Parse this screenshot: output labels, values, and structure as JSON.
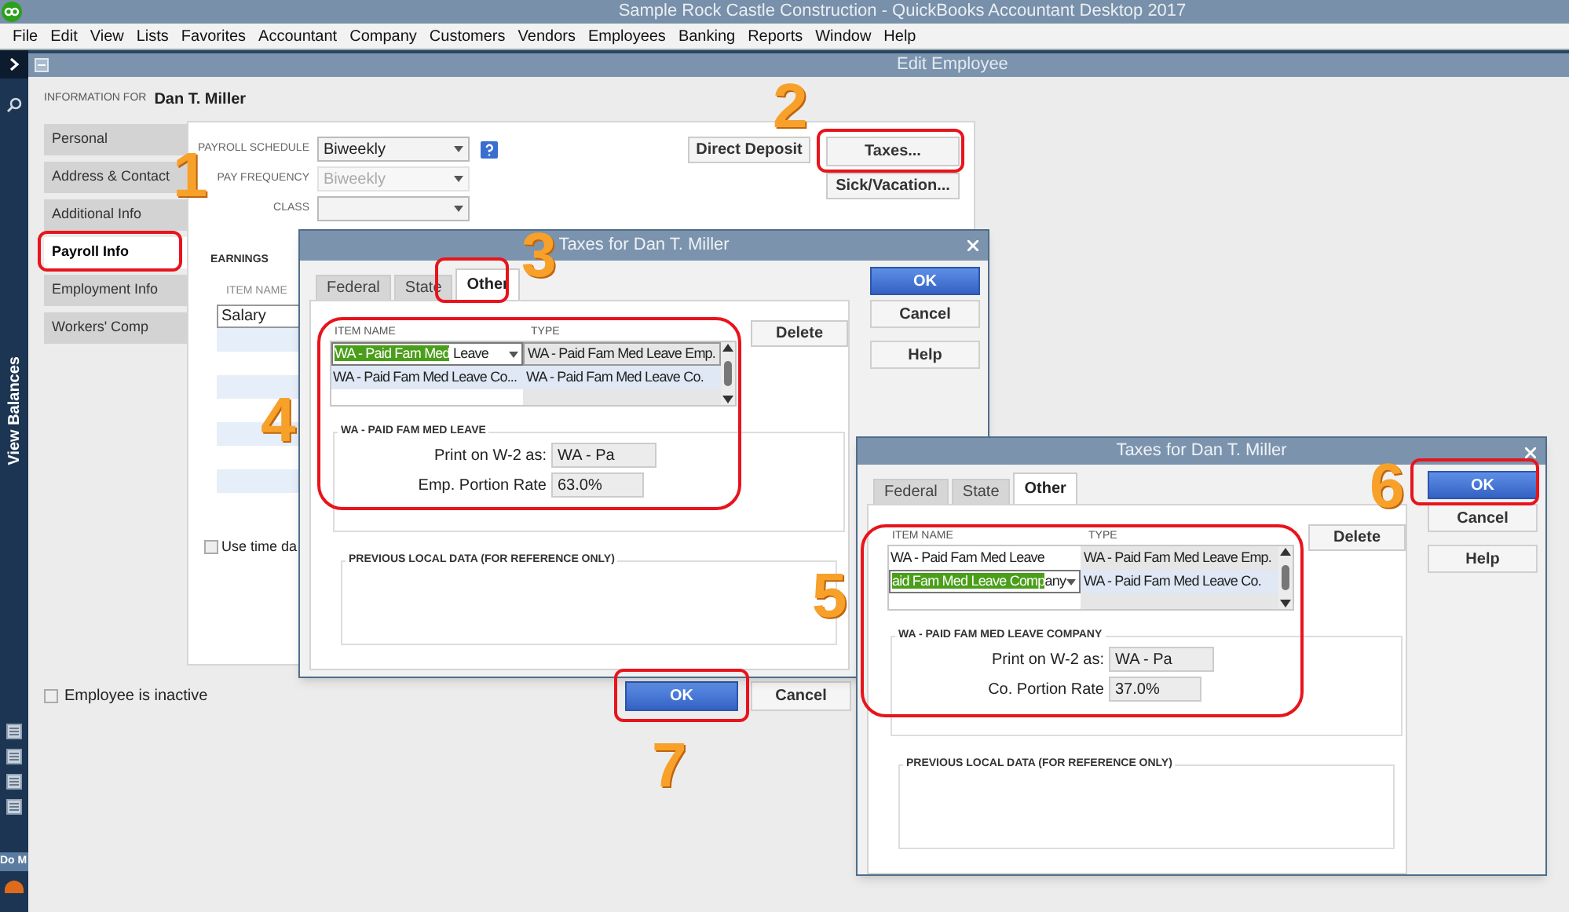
{
  "app_title": "Sample Rock Castle Construction  - QuickBooks Accountant Desktop 2017",
  "menu": [
    "File",
    "Edit",
    "View",
    "Lists",
    "Favorites",
    "Accountant",
    "Company",
    "Customers",
    "Vendors",
    "Employees",
    "Banking",
    "Reports",
    "Window",
    "Help"
  ],
  "sidebar": {
    "label": "View Balances",
    "bottom_label": "Do M"
  },
  "edit_employee": {
    "title": "Edit Employee",
    "info_label": "INFORMATION FOR",
    "employee_name": "Dan T. Miller",
    "tabs": [
      {
        "label": "Personal",
        "selected": false
      },
      {
        "label": "Address & Contact",
        "selected": false
      },
      {
        "label": "Additional Info",
        "selected": false
      },
      {
        "label": "Payroll Info",
        "selected": true
      },
      {
        "label": "Employment Info",
        "selected": false
      },
      {
        "label": "Workers' Comp",
        "selected": false
      }
    ],
    "fields": [
      {
        "label": "PAYROLL SCHEDULE",
        "value": "Biweekly",
        "disabled": false,
        "help": true
      },
      {
        "label": "PAY FREQUENCY",
        "value": "Biweekly",
        "disabled": true,
        "help": false
      },
      {
        "label": "CLASS",
        "disabled": false,
        "help": false
      }
    ],
    "side_buttons": [
      "Direct Deposit",
      "Taxes...",
      "Sick/Vacation..."
    ],
    "earnings": {
      "title": "EARNINGS",
      "column": "ITEM NAME",
      "rows": [
        "Salary"
      ]
    },
    "use_time_data": {
      "label": "Use time da",
      "checked": false
    },
    "inactive": {
      "label": "Employee is inactive",
      "checked": false
    },
    "buttons": [
      {
        "label": "OK",
        "kind": "primary"
      },
      {
        "label": "Cancel",
        "kind": "normal"
      }
    ]
  },
  "tax_dialogs": [
    {
      "title": "Taxes for Dan T. Miller",
      "tabs": [
        {
          "label": "Federal",
          "selected": false
        },
        {
          "label": "State",
          "selected": false
        },
        {
          "label": "Other",
          "selected": true
        }
      ],
      "columns": [
        "ITEM NAME",
        "TYPE"
      ],
      "rows": [
        {
          "highlighted": "WA - Paid Fam Med",
          "name": " Leave",
          "type": "WA - Paid Fam Med Leave Emp.",
          "editing": true
        },
        {
          "name": "WA - Paid Fam Med Leave Co...",
          "type": "WA - Paid Fam Med Leave Co.",
          "editing": false
        }
      ],
      "delete": "Delete",
      "section_title": "WA - PAID FAM MED LEAVE",
      "print_label": "Print on W-2 as:",
      "print_value": "WA - Pa",
      "rate_label": "Emp. Portion Rate",
      "rate_value": "63.0%",
      "previous_title": "PREVIOUS LOCAL DATA (FOR REFERENCE ONLY)",
      "buttons": [
        {
          "label": "OK",
          "kind": "primary"
        },
        {
          "label": "Cancel",
          "kind": "normal"
        },
        {
          "label": "Help",
          "kind": "normal"
        }
      ]
    },
    {
      "title": "Taxes for Dan T. Miller",
      "tabs": [
        {
          "label": "Federal",
          "selected": false
        },
        {
          "label": "State",
          "selected": false
        },
        {
          "label": "Other",
          "selected": true
        }
      ],
      "columns": [
        "ITEM NAME",
        "TYPE"
      ],
      "rows": [
        {
          "name": "WA - Paid Fam Med Leave",
          "type": "WA - Paid Fam Med Leave Emp.",
          "editing": false
        },
        {
          "highlighted": "aid Fam Med Leave Comp",
          "name": "any",
          "type": "WA - Paid Fam Med Leave Co.",
          "editing": true
        }
      ],
      "delete": "Delete",
      "section_title": "WA - PAID FAM MED LEAVE COMPANY",
      "print_label": "Print on W-2 as:",
      "print_value": "WA - Pa",
      "rate_label": "Co. Portion Rate",
      "rate_value": "37.0%",
      "previous_title": "PREVIOUS LOCAL DATA (FOR REFERENCE ONLY)",
      "buttons": [
        {
          "label": "OK",
          "kind": "primary"
        },
        {
          "label": "Cancel",
          "kind": "normal"
        },
        {
          "label": "Help",
          "kind": "normal"
        }
      ]
    }
  ],
  "annotations": [
    {
      "label": "1"
    },
    {
      "label": "2"
    },
    {
      "label": "3"
    },
    {
      "label": "4"
    },
    {
      "label": "5"
    },
    {
      "label": "6"
    },
    {
      "label": "7"
    }
  ]
}
